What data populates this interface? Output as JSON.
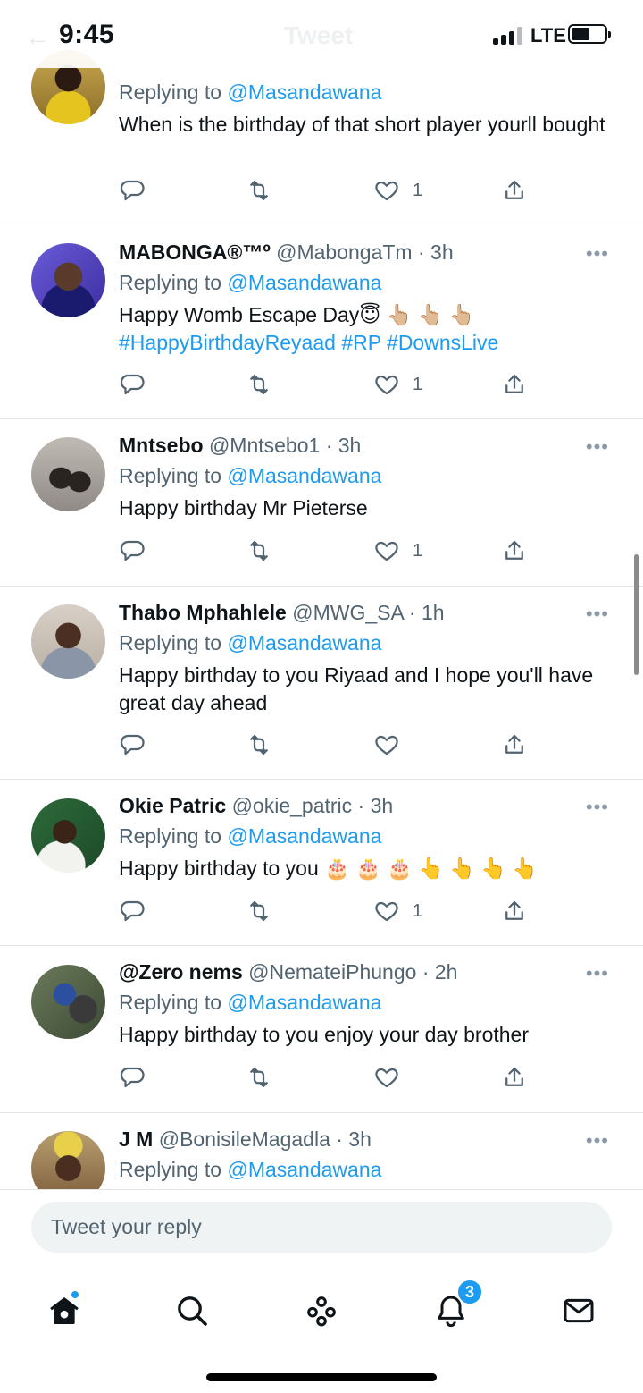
{
  "status": {
    "time": "9:45",
    "network": "LTE",
    "ghost_title": "Tweet"
  },
  "colors": {
    "accent": "#1d9bf0",
    "muted": "#536471",
    "text": "#0f1419"
  },
  "tweets": [
    {
      "name": "",
      "handle": "",
      "time": "",
      "replying_label": "Replying to",
      "mention": "@Masandawana",
      "text": "When is the birthday of that short player yourll bought",
      "hashtags": "",
      "likes": "1"
    },
    {
      "name": "MABONGA®™º",
      "handle": "@MabongaTm · 3h",
      "time": "",
      "replying_label": "Replying to",
      "mention": "@Masandawana",
      "text": "Happy Womb Escape Day😇 👆🏼 👆🏼 👆🏼",
      "hashtags": "#HappyBirthdayReyaad #RP #DownsLive",
      "likes": "1"
    },
    {
      "name": "Mntsebo",
      "handle": "@Mntsebo1 · 3h",
      "time": "",
      "replying_label": "Replying to",
      "mention": "@Masandawana",
      "text": "Happy birthday Mr Pieterse",
      "hashtags": "",
      "likes": "1"
    },
    {
      "name": "Thabo Mphahlele",
      "handle": "@MWG_SA · 1h",
      "time": "",
      "replying_label": "Replying to",
      "mention": "@Masandawana",
      "text": "Happy birthday to you Riyaad and I hope you'll have great day ahead",
      "hashtags": "",
      "likes": ""
    },
    {
      "name": "Okie Patric",
      "handle": "@okie_patric · 3h",
      "time": "",
      "replying_label": "Replying to",
      "mention": "@Masandawana",
      "text": "Happy birthday to you 🎂 🎂 🎂 👆 👆 👆 👆",
      "hashtags": "",
      "likes": "1"
    },
    {
      "name": "@Zero nems",
      "handle": "@NemateiPhungo · 2h",
      "time": "",
      "replying_label": "Replying to",
      "mention": "@Masandawana",
      "text": "Happy birthday to you enjoy your day brother",
      "hashtags": "",
      "likes": ""
    },
    {
      "name": "J M",
      "handle": "@BonisileMagadla · 3h",
      "time": "",
      "replying_label": "Replying to",
      "mention": "@Masandawana",
      "text": "",
      "hashtags": "",
      "likes": ""
    }
  ],
  "reply_box": {
    "placeholder": "Tweet your reply"
  },
  "tabs": {
    "notifications_badge": "3",
    "items": [
      "home-icon",
      "search-icon",
      "spaces-icon",
      "notifications-icon",
      "messages-icon"
    ]
  }
}
